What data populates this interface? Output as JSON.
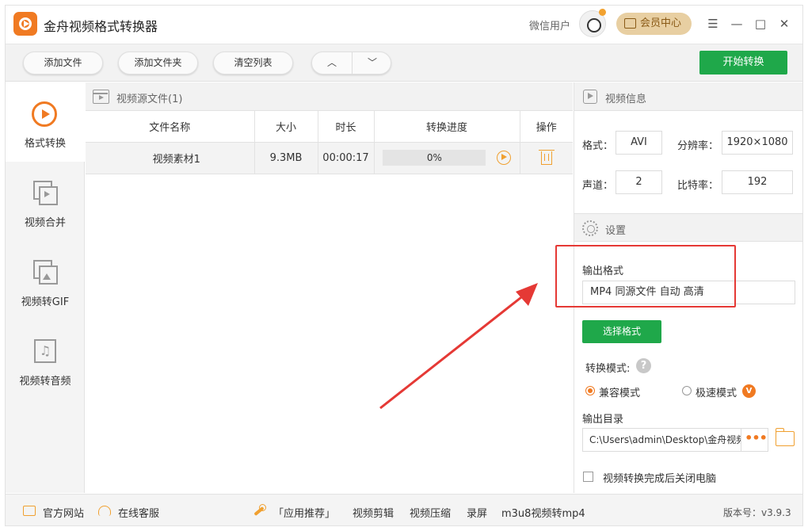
{
  "app": {
    "title": "金舟视频格式转换器",
    "user_name": "微信用户",
    "vip_label": "会员中心"
  },
  "window_controls": {
    "menu": "☰",
    "minimize": "—",
    "maximize": "□",
    "close": "✕"
  },
  "toolbar": {
    "add_file": "添加文件",
    "add_folder": "添加文件夹",
    "clear_list": "清空列表",
    "move_up": "︿",
    "move_down": "﹀",
    "start": "开始转换"
  },
  "sidebar": {
    "items": [
      {
        "label": "格式转换",
        "icon": "convert-icon",
        "active": true
      },
      {
        "label": "视频合并",
        "icon": "merge-icon",
        "active": false
      },
      {
        "label": "视频转GIF",
        "icon": "gif-icon",
        "active": false
      },
      {
        "label": "视频转音频",
        "icon": "audio-icon",
        "active": false
      }
    ]
  },
  "source": {
    "title": "视频源文件(1)",
    "columns": [
      "文件名称",
      "大小",
      "时长",
      "转换进度",
      "操作"
    ],
    "rows": [
      {
        "name": "视频素材1",
        "size": "9.3MB",
        "duration": "00:00:17",
        "progress_text": "0%",
        "progress": 0
      }
    ]
  },
  "video_info": {
    "title": "视频信息",
    "format_label": "格式：",
    "format": "AVI",
    "resolution_label": "分辨率：",
    "resolution": "1920×1080",
    "channel_label": "声道：",
    "channel": "2",
    "bitrate_label": "比特率：",
    "bitrate": "192"
  },
  "settings": {
    "title": "设置",
    "output_format_label": "输出格式",
    "output_format": "MP4 同源文件 自动 高清",
    "choose_format": "选择格式",
    "mode_label": "转换模式:",
    "help": "?",
    "mode_compatible": "兼容模式",
    "mode_fast": "极速模式",
    "vip_badge": "V",
    "selected_mode": "兼容模式",
    "output_dir_label": "输出目录",
    "output_dir": "C:\\Users\\admin\\Desktop\\金舟视频格式转换器",
    "dir_more": "•••",
    "shutdown_label": "视频转换完成后关闭电脑",
    "shutdown_checked": false
  },
  "footer": {
    "site": "官方网站",
    "service": "在线客服",
    "recommend": "「应用推荐」",
    "links": [
      "视频剪辑",
      "视频压缩",
      "录屏",
      "m3u8视频转mp4"
    ],
    "version": "版本号：v3.9.3"
  },
  "colors": {
    "accent": "#f07a22",
    "primary_green": "#1fa84a",
    "highlight_red": "#e53935",
    "vip_gold": "#e8cfa2"
  }
}
